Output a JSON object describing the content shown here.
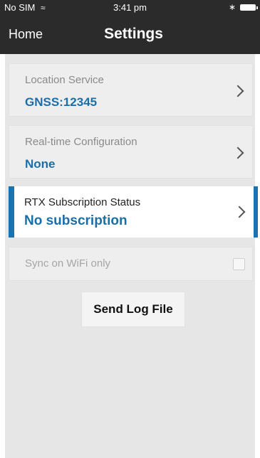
{
  "status_bar": {
    "carrier": "No SIM",
    "time": "3:41 pm",
    "icons": [
      "wifi-icon",
      "bluetooth-icon",
      "battery-icon"
    ]
  },
  "nav": {
    "back_label": "Home",
    "title": "Settings"
  },
  "rows": [
    {
      "label": "Location Service",
      "value": "GNSS:12345"
    },
    {
      "label": "Real-time Configuration",
      "value": "None"
    },
    {
      "label": "RTX Subscription Status",
      "value": "No subscription"
    },
    {
      "label": "Sync on WiFi only",
      "checked": false
    }
  ],
  "actions": {
    "send_log_label": "Send Log File"
  },
  "colors": {
    "bar_bg": "#2b2b2b",
    "accent": "#1a73b0",
    "value_text": "#1a6fa8",
    "panel_bg": "#e6e6e6"
  }
}
